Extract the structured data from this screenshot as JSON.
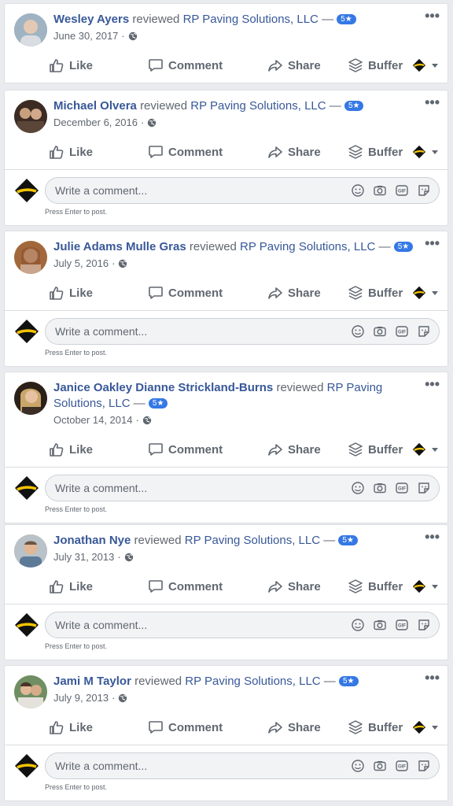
{
  "reviewed_text": "reviewed",
  "dash": "—",
  "actions": {
    "like": "Like",
    "comment": "Comment",
    "share": "Share",
    "buffer": "Buffer"
  },
  "comment_placeholder": "Write a comment...",
  "press_enter_hint": "Press Enter to post.",
  "more_label": "•••",
  "colors": {
    "link": "#385898",
    "badge": "#3578e5",
    "background": "#e9ebee"
  },
  "posts": [
    {
      "author": "Wesley Ayers",
      "page": "RP Paving Solutions, LLC",
      "rating": "5★",
      "date": "June 30, 2017",
      "privacy_icon": "globe-icon",
      "has_comment_box": false
    },
    {
      "author": "Michael Olvera",
      "page": "RP Paving Solutions, LLC",
      "rating": "5★",
      "date": "December 6, 2016",
      "privacy_icon": "globe-icon",
      "has_comment_box": true
    },
    {
      "author": "Julie Adams Mulle Gras",
      "page": "RP Paving Solutions, LLC",
      "rating": "5★",
      "date": "July 5, 2016",
      "privacy_icon": "globe-icon",
      "has_comment_box": true
    },
    {
      "author": "Janice Oakley Dianne Strickland-Burns",
      "page": "RP Paving Solutions, LLC",
      "rating": "5★",
      "date": "October 14, 2014",
      "privacy_icon": "globe-icon",
      "has_comment_box": true
    },
    {
      "author": "Jonathan Nye",
      "page": "RP Paving Solutions, LLC",
      "rating": "5★",
      "date": "July 31, 2013",
      "privacy_icon": "globe-icon",
      "has_comment_box": true
    },
    {
      "author": "Jami M Taylor",
      "page": "RP Paving Solutions, LLC",
      "rating": "5★",
      "date": "July 9, 2013",
      "privacy_icon": "globe-icon",
      "has_comment_box": true
    }
  ]
}
